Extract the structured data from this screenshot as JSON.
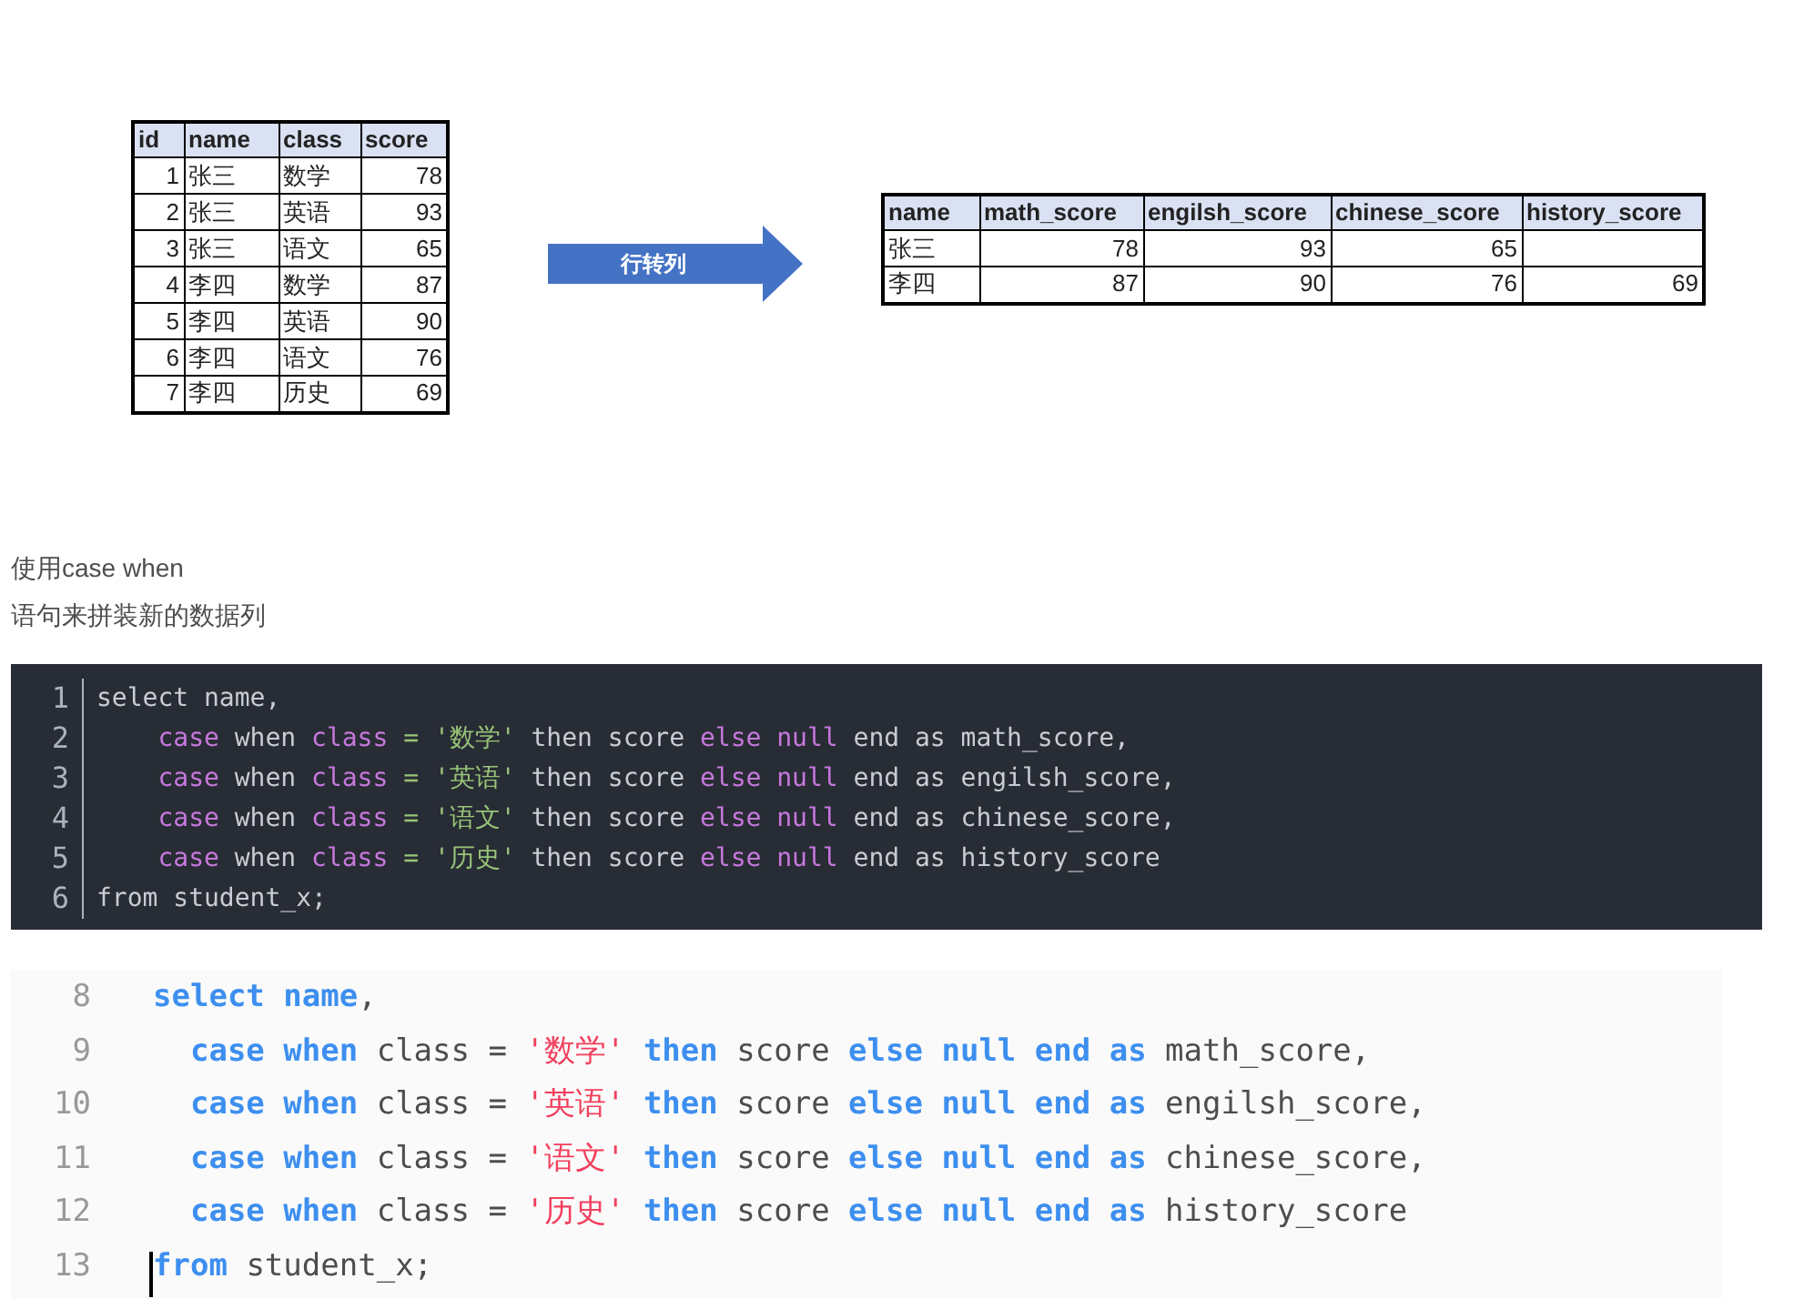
{
  "source_table": {
    "columns": [
      "id",
      "name",
      "class",
      "score"
    ],
    "rows": [
      [
        "1",
        "张三",
        "数学",
        "78"
      ],
      [
        "2",
        "张三",
        "英语",
        "93"
      ],
      [
        "3",
        "张三",
        "语文",
        "65"
      ],
      [
        "4",
        "李四",
        "数学",
        "87"
      ],
      [
        "5",
        "李四",
        "英语",
        "90"
      ],
      [
        "6",
        "李四",
        "语文",
        "76"
      ],
      [
        "7",
        "李四",
        "历史",
        "69"
      ]
    ]
  },
  "arrow": {
    "label": "行转列"
  },
  "result_table": {
    "columns": [
      "name",
      "math_score",
      "engilsh_score",
      "chinese_score",
      "history_score"
    ],
    "rows": [
      [
        "张三",
        "78",
        "93",
        "65",
        ""
      ],
      [
        "李四",
        "87",
        "90",
        "76",
        "69"
      ]
    ]
  },
  "paragraphs": [
    "使用case when",
    "语句来拼装新的数据列"
  ],
  "code_blocks": [
    {
      "kind": "dark",
      "lines": [
        {
          "number": "1",
          "cursor": false,
          "tokens": [
            {
              "kind": "plain",
              "text": "select name,"
            }
          ]
        },
        {
          "number": "2",
          "cursor": false,
          "tokens": [
            {
              "kind": "keyword",
              "text": "    case"
            },
            {
              "kind": "plain",
              "text": " when "
            },
            {
              "kind": "keyword",
              "text": "class"
            },
            {
              "kind": "string",
              "text": " = '数学'"
            },
            {
              "kind": "plain",
              "text": " then score "
            },
            {
              "kind": "keyword",
              "text": "else null"
            },
            {
              "kind": "plain",
              "text": " end as math_score,"
            }
          ]
        },
        {
          "number": "3",
          "cursor": false,
          "tokens": [
            {
              "kind": "keyword",
              "text": "    case"
            },
            {
              "kind": "plain",
              "text": " when "
            },
            {
              "kind": "keyword",
              "text": "class"
            },
            {
              "kind": "string",
              "text": " = '英语'"
            },
            {
              "kind": "plain",
              "text": " then score "
            },
            {
              "kind": "keyword",
              "text": "else null"
            },
            {
              "kind": "plain",
              "text": " end as engilsh_score,"
            }
          ]
        },
        {
          "number": "4",
          "cursor": false,
          "tokens": [
            {
              "kind": "keyword",
              "text": "    case"
            },
            {
              "kind": "plain",
              "text": " when "
            },
            {
              "kind": "keyword",
              "text": "class"
            },
            {
              "kind": "string",
              "text": " = '语文'"
            },
            {
              "kind": "plain",
              "text": " then score "
            },
            {
              "kind": "keyword",
              "text": "else null"
            },
            {
              "kind": "plain",
              "text": " end as chinese_score,"
            }
          ]
        },
        {
          "number": "5",
          "cursor": false,
          "tokens": [
            {
              "kind": "keyword",
              "text": "    case"
            },
            {
              "kind": "plain",
              "text": " when "
            },
            {
              "kind": "keyword",
              "text": "class"
            },
            {
              "kind": "string",
              "text": " = '历史'"
            },
            {
              "kind": "plain",
              "text": " then score "
            },
            {
              "kind": "keyword",
              "text": "else null"
            },
            {
              "kind": "plain",
              "text": " end as history_score"
            }
          ]
        },
        {
          "number": "6",
          "cursor": false,
          "tokens": [
            {
              "kind": "plain",
              "text": "from student_x;"
            }
          ]
        }
      ]
    },
    {
      "kind": "light",
      "lines": [
        {
          "number": "8",
          "cursor": false,
          "tokens": [
            {
              "kind": "keyword",
              "text": "select name"
            },
            {
              "kind": "plain",
              "text": ","
            }
          ]
        },
        {
          "number": "9",
          "cursor": false,
          "tokens": [
            {
              "kind": "keyword",
              "text": "  case when"
            },
            {
              "kind": "plain",
              "text": " class = "
            },
            {
              "kind": "string",
              "text": "'数学'"
            },
            {
              "kind": "keyword",
              "text": " then"
            },
            {
              "kind": "plain",
              "text": " score "
            },
            {
              "kind": "keyword",
              "text": "else null end as"
            },
            {
              "kind": "plain",
              "text": " math_score,"
            }
          ]
        },
        {
          "number": "10",
          "cursor": false,
          "tokens": [
            {
              "kind": "keyword",
              "text": "  case when"
            },
            {
              "kind": "plain",
              "text": " class = "
            },
            {
              "kind": "string",
              "text": "'英语'"
            },
            {
              "kind": "keyword",
              "text": " then"
            },
            {
              "kind": "plain",
              "text": " score "
            },
            {
              "kind": "keyword",
              "text": "else null end as"
            },
            {
              "kind": "plain",
              "text": " engilsh_score,"
            }
          ]
        },
        {
          "number": "11",
          "cursor": false,
          "tokens": [
            {
              "kind": "keyword",
              "text": "  case when"
            },
            {
              "kind": "plain",
              "text": " class = "
            },
            {
              "kind": "string",
              "text": "'语文'"
            },
            {
              "kind": "keyword",
              "text": " then"
            },
            {
              "kind": "plain",
              "text": " score "
            },
            {
              "kind": "keyword",
              "text": "else null end as"
            },
            {
              "kind": "plain",
              "text": " chinese_score,"
            }
          ]
        },
        {
          "number": "12",
          "cursor": false,
          "tokens": [
            {
              "kind": "keyword",
              "text": "  case when"
            },
            {
              "kind": "plain",
              "text": " class = "
            },
            {
              "kind": "string",
              "text": "'历史'"
            },
            {
              "kind": "keyword",
              "text": " then"
            },
            {
              "kind": "plain",
              "text": " score "
            },
            {
              "kind": "keyword",
              "text": "else null end as"
            },
            {
              "kind": "plain",
              "text": " history_score"
            }
          ]
        },
        {
          "number": "13",
          "cursor": true,
          "tokens": [
            {
              "kind": "keyword",
              "text": "from"
            },
            {
              "kind": "plain",
              "text": " student_x;"
            }
          ]
        }
      ]
    }
  ]
}
